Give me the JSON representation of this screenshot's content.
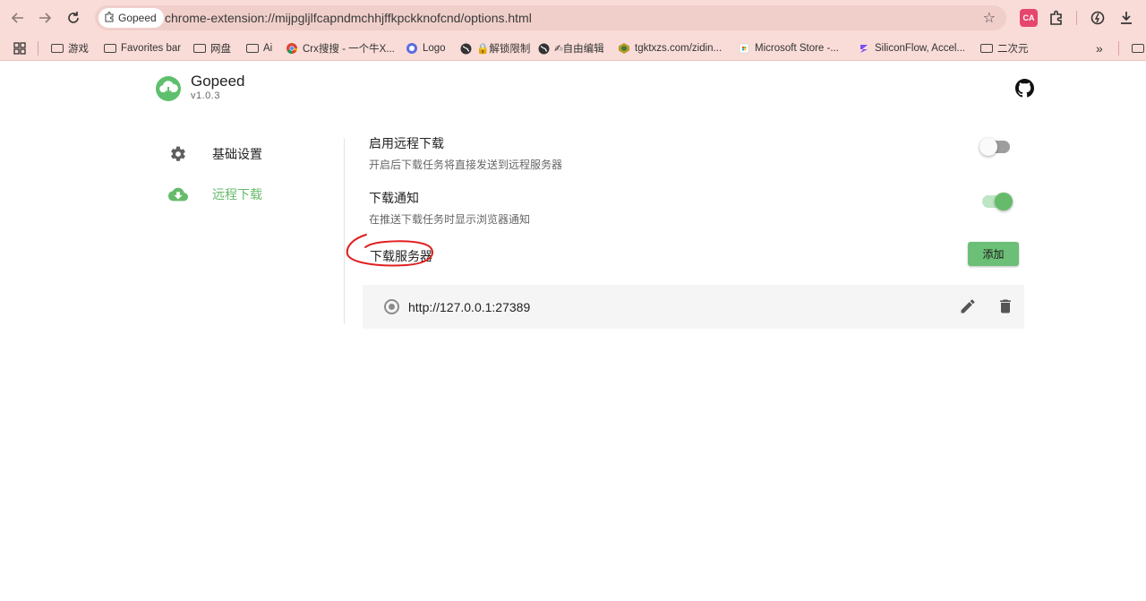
{
  "browser": {
    "tab_chip": "Gopeed",
    "url": "chrome-extension://mijpgljlfcapndmchhjffkpckknofcnd/options.html",
    "ext_badge": "CA"
  },
  "bookmarks": [
    {
      "label": "游戏",
      "icon": "folder-icon"
    },
    {
      "label": "Favorites bar",
      "icon": "folder-icon"
    },
    {
      "label": "网盘",
      "icon": "folder-icon"
    },
    {
      "label": "Ai",
      "icon": "folder-icon"
    },
    {
      "label": "Crx搜搜 - 一个牛X...",
      "icon": "chrome-icon"
    },
    {
      "label": "Logo",
      "icon": "logo-icon"
    },
    {
      "label": "🔒解锁限制",
      "icon": "globe-icon"
    },
    {
      "label": "✍自由编辑",
      "icon": "globe-icon"
    },
    {
      "label": "tgktxzs.com/zidin...",
      "icon": "site-icon"
    },
    {
      "label": "Microsoft Store -...",
      "icon": "store-icon"
    },
    {
      "label": "SiliconFlow, Accel...",
      "icon": "siliconflow-icon"
    },
    {
      "label": "二次元",
      "icon": "folder-icon"
    }
  ],
  "app": {
    "name": "Gopeed",
    "version": "v1.0.3"
  },
  "sidebar": {
    "items": [
      {
        "label": "基础设置",
        "icon": "gear-icon",
        "active": false
      },
      {
        "label": "远程下载",
        "icon": "cloud-download-icon",
        "active": true
      }
    ]
  },
  "settings": {
    "remote": {
      "title": "启用远程下载",
      "desc": "开启后下载任务将直接发送到远程服务器",
      "enabled": false
    },
    "notify": {
      "title": "下载通知",
      "desc": "在推送下载任务时显示浏览器通知",
      "enabled": true
    }
  },
  "servers": {
    "title": "下载服务器",
    "add_label": "添加",
    "items": [
      {
        "url": "http://127.0.0.1:27389",
        "selected": false
      }
    ]
  },
  "colors": {
    "accent": "#66bb6a",
    "chrome_bg": "#f9dcd7",
    "annotation": "#e02020"
  }
}
